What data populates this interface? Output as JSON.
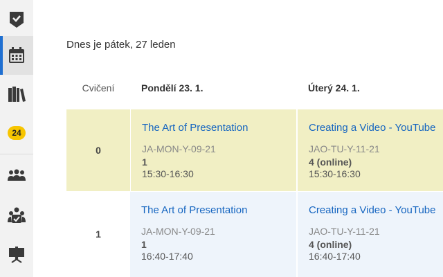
{
  "sidebar": {
    "items": [
      {
        "icon": "logo-check-shield-icon",
        "active": false
      },
      {
        "icon": "calendar-icon",
        "active": true
      },
      {
        "icon": "books-icon",
        "active": false
      },
      {
        "icon": "notification-badge",
        "badge": "24",
        "active": false
      },
      {
        "icon": "group-icon",
        "active": false
      },
      {
        "icon": "group-check-icon",
        "active": false
      },
      {
        "icon": "presentation-board-icon",
        "active": false
      }
    ]
  },
  "today": "Dnes je pátek, 27 leden",
  "table": {
    "col_exercise": "Cvičení",
    "days": [
      "Pondělí 23. 1.",
      "Úterý 24. 1."
    ],
    "rows": [
      {
        "number": "0",
        "bg": "#f1efc4",
        "cells": [
          {
            "title": "The Art of Presentation",
            "code": "JA-MON-Y-09-21",
            "room": "1",
            "time": "15:30-16:30"
          },
          {
            "title": "Creating a Video - YouTube",
            "code": "JAO-TU-Y-11-21",
            "room": "4 (online)",
            "time": "15:30-16:30"
          }
        ]
      },
      {
        "number": "1",
        "bg": "#eef4fb",
        "cells": [
          {
            "title": "The Art of Presentation",
            "code": "JA-MON-Y-09-21",
            "room": "1",
            "time": "16:40-17:40"
          },
          {
            "title": "Creating a Video - YouTube",
            "code": "JAO-TU-Y-11-21",
            "room": "4 (online)",
            "time": "16:40-17:40"
          }
        ]
      }
    ]
  },
  "colors": {
    "accent": "#1f6fd1",
    "link": "#1565c0",
    "badge": "#f7c500",
    "row0_bg": "#f1efc4",
    "row1_bg": "#eef4fb"
  }
}
